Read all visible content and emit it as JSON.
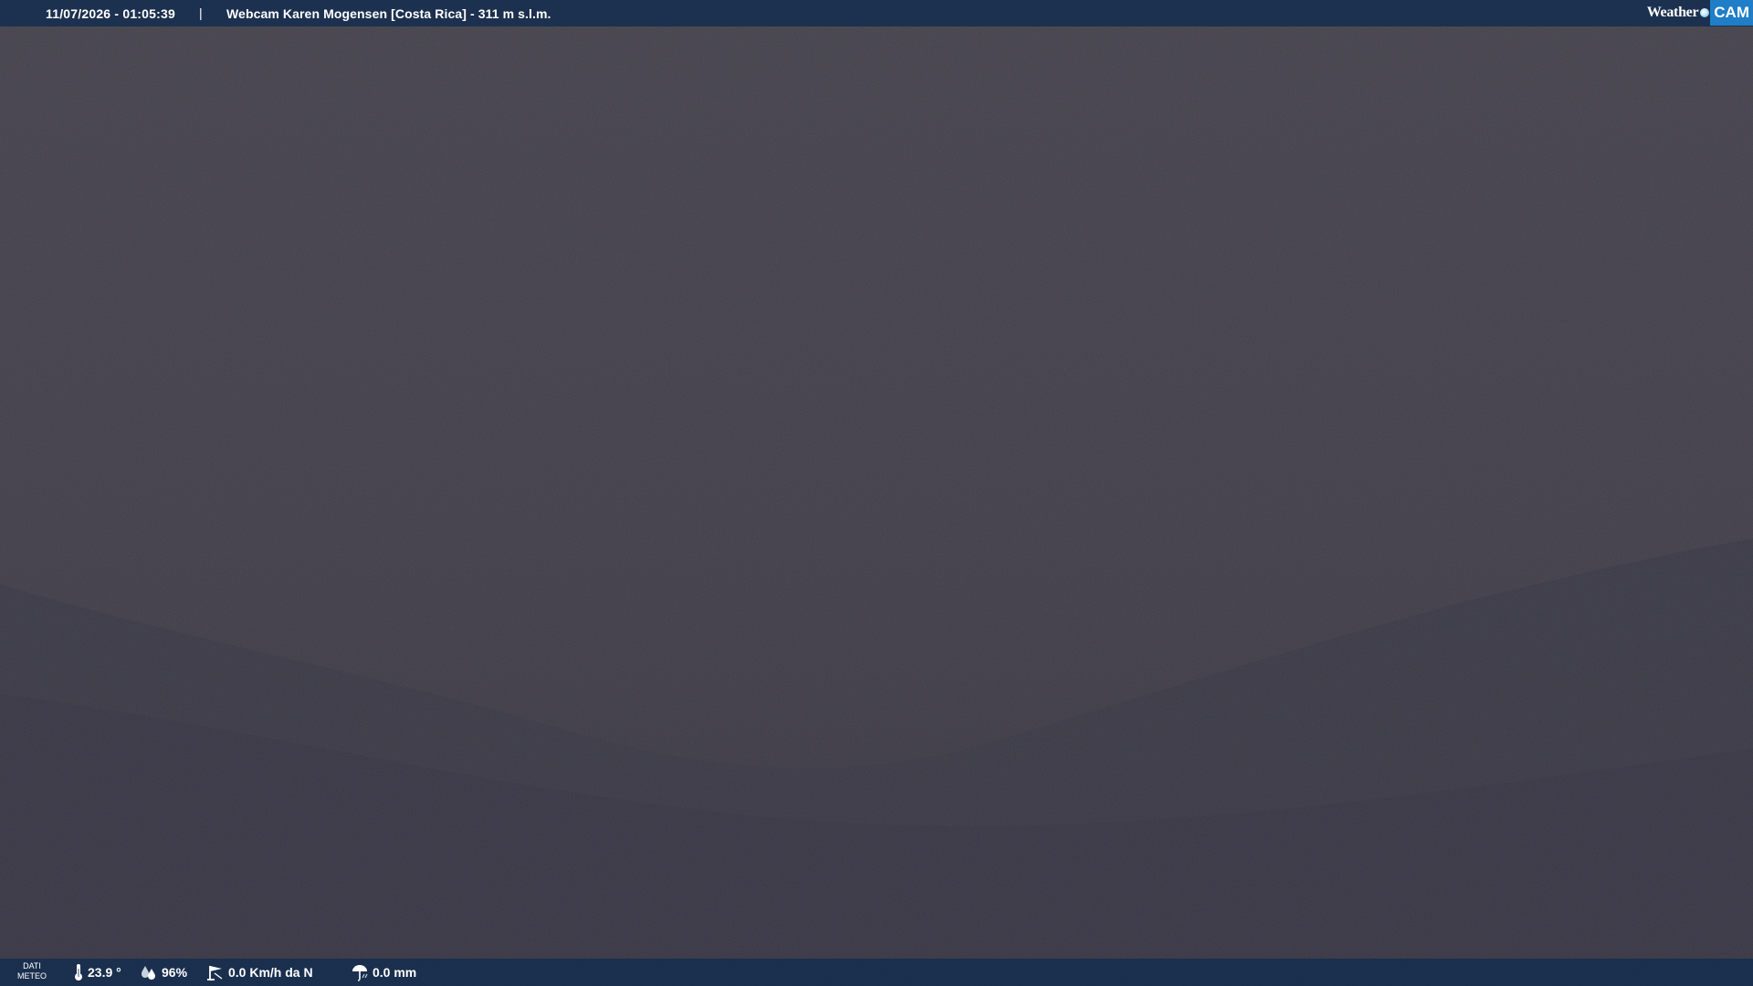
{
  "header": {
    "datetime": "11/07/2026 - 01:05:39",
    "separator": "|",
    "title": "Webcam Karen Mogensen [Costa Rica]  - 311 m s.l.m."
  },
  "logo": {
    "weather_text": "Weather",
    "cam_text": "CAM"
  },
  "footer": {
    "dati_line1": "DATI",
    "dati_line2": "METEO",
    "temperature": "23.9 °",
    "humidity": "96%",
    "wind": "0.0 Km/h da N",
    "rain": "0.0 mm"
  },
  "icons": {
    "temperature": "thermometer-icon",
    "humidity": "humidity-drops-icon",
    "wind": "wind-vane-icon",
    "rain": "rain-gauge-icon"
  },
  "colors": {
    "bar_background": "#162d4e",
    "logo_cam_background": "#1f7ec7",
    "text": "#ffffff"
  }
}
